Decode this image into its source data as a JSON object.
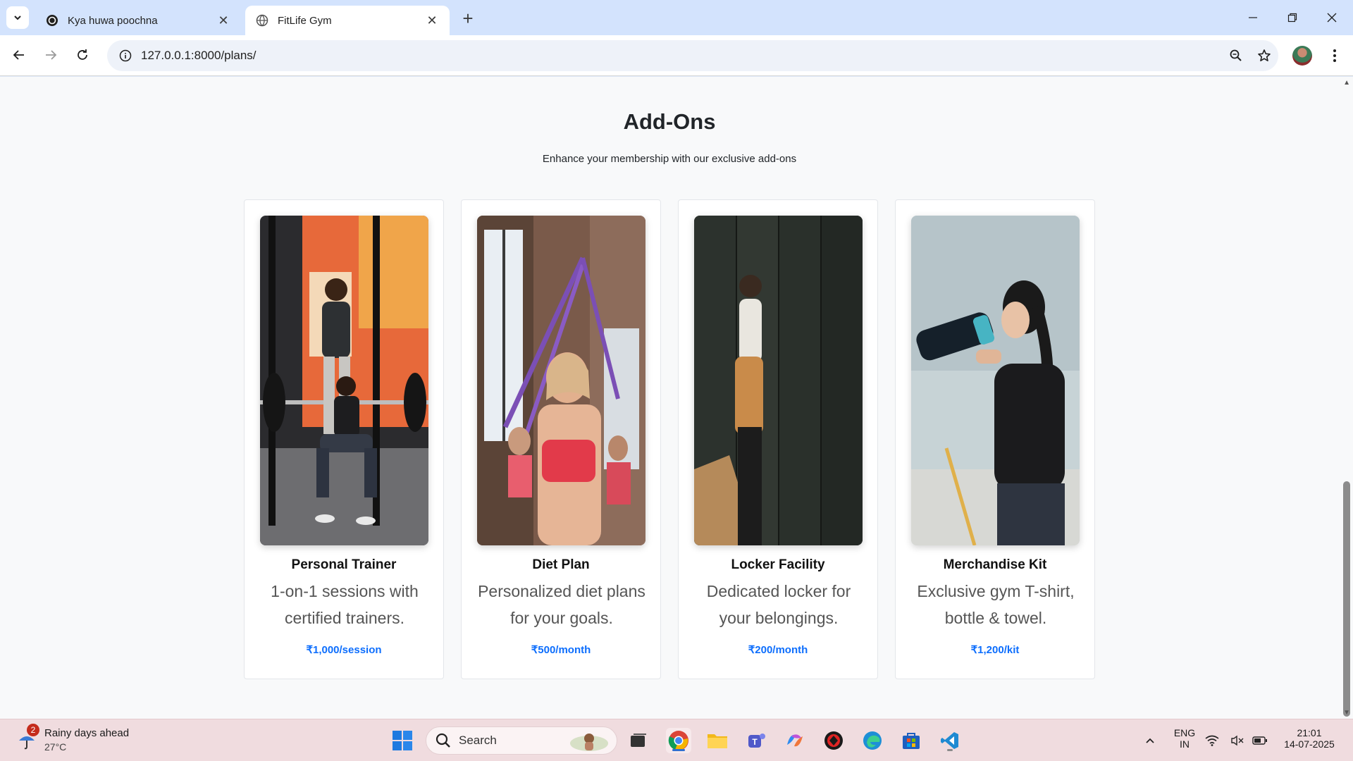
{
  "browser": {
    "tabs": [
      {
        "title": "Kya huwa poochna",
        "active": false
      },
      {
        "title": "FitLife Gym",
        "active": true
      }
    ],
    "url": "127.0.0.1:8000/plans/"
  },
  "page": {
    "title": "Add-Ons",
    "subtitle": "Enhance your membership with our exclusive add-ons",
    "accent_color": "#0d6efd",
    "addons": [
      {
        "name": "Personal Trainer",
        "description": "1-on-1 sessions with certified trainers.",
        "price": "₹1,000/session",
        "image": "trainer-squat-photo"
      },
      {
        "name": "Diet Plan",
        "description": "Personalized diet plans for your goals.",
        "price": "₹500/month",
        "image": "resistance-band-class-photo"
      },
      {
        "name": "Locker Facility",
        "description": "Dedicated locker for your belongings.",
        "price": "₹200/month",
        "image": "locker-room-photo"
      },
      {
        "name": "Merchandise Kit",
        "description": "Exclusive gym T-shirt, bottle & towel.",
        "price": "₹1,200/kit",
        "image": "woman-drinking-bottle-photo"
      }
    ]
  },
  "taskbar": {
    "weather": {
      "badge": "2",
      "headline": "Rainy days ahead",
      "temp": "27°C"
    },
    "search_label": "Search",
    "language": {
      "line1": "ENG",
      "line2": "IN"
    },
    "clock": {
      "time": "21:01",
      "date": "14-07-2025"
    }
  }
}
